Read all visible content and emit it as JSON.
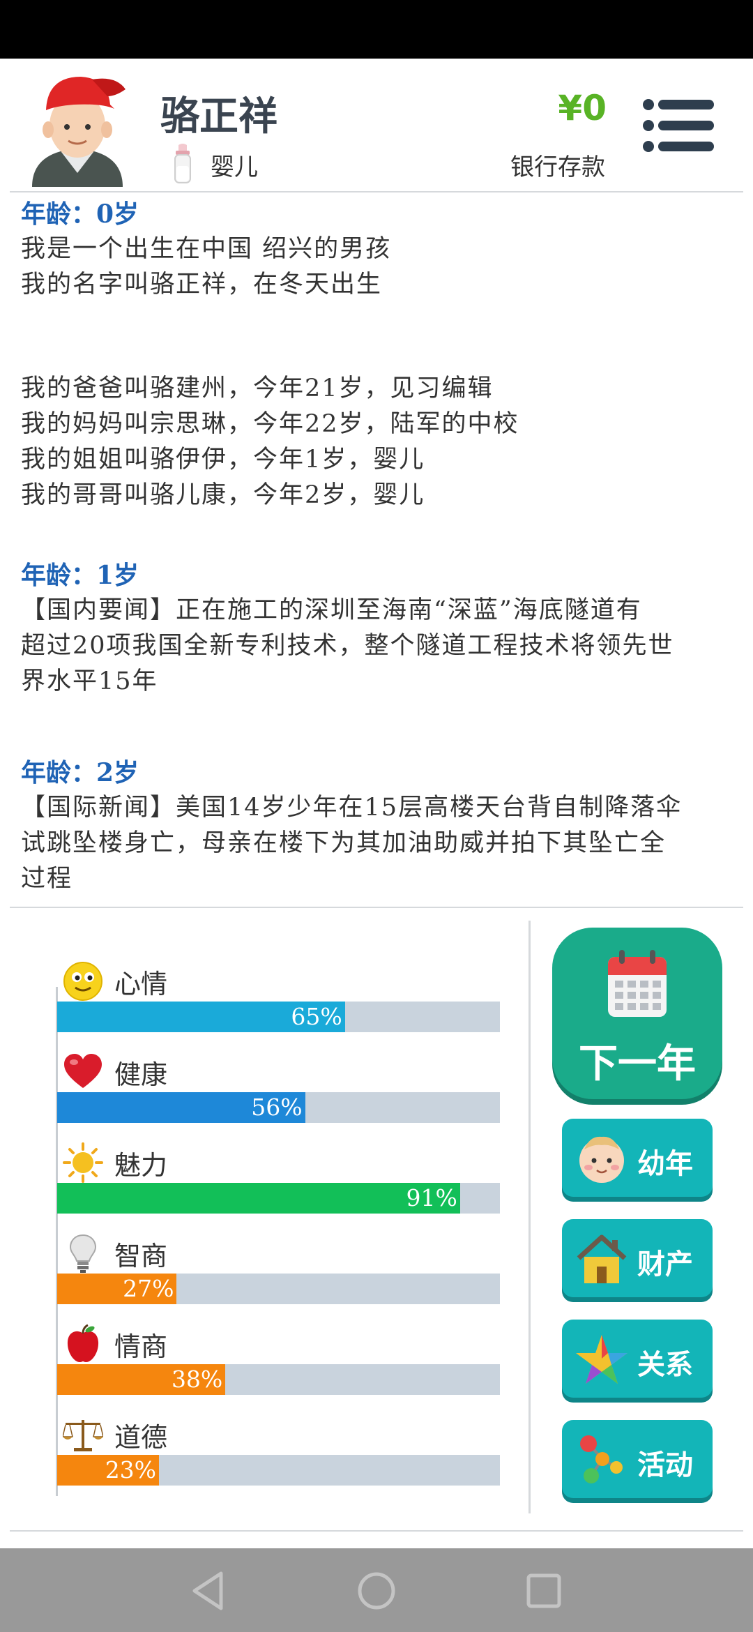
{
  "header": {
    "name": "骆正祥",
    "stage": "婴儿",
    "money": "¥0",
    "bank_label": "银行存款"
  },
  "log": {
    "age0": "年龄：0岁",
    "age0_l1": "我是一个出生在中国 绍兴的男孩",
    "age0_l2": "我的名字叫骆正祥，在冬天出生",
    "fam_l1": "我的爸爸叫骆建州，今年21岁，见习编辑",
    "fam_l2": "我的妈妈叫宗思琳，今年22岁，陆军的中校",
    "fam_l3": "我的姐姐叫骆伊伊，今年1岁，婴儿",
    "fam_l4": "我的哥哥叫骆儿康，今年2岁，婴儿",
    "age1": "年龄：1岁",
    "age1_l1": "【国内要闻】正在施工的深圳至海南“深蓝”海底隧道有",
    "age1_l2": "超过20项我国全新专利技术，整个隧道工程技术将领先世",
    "age1_l3": "界水平15年",
    "age2": "年龄：2岁",
    "age2_l1": "【国际新闻】美国14岁少年在15层高楼天台背自制降落伞",
    "age2_l2": "试跳坠楼身亡，母亲在楼下为其加油助威并拍下其坠亡全",
    "age2_l3": "过程"
  },
  "stats": [
    {
      "label": "心情",
      "value": 65,
      "pct": "65%",
      "color": "#1aaad9",
      "icon": "smiley-icon"
    },
    {
      "label": "健康",
      "value": 56,
      "pct": "56%",
      "color": "#1e88d8",
      "icon": "heart-icon"
    },
    {
      "label": "魅力",
      "value": 91,
      "pct": "91%",
      "color": "#12bf58",
      "icon": "sun-icon"
    },
    {
      "label": "智商",
      "value": 27,
      "pct": "27%",
      "color": "#f5860e",
      "icon": "lightbulb-icon"
    },
    {
      "label": "情商",
      "value": 38,
      "pct": "38%",
      "color": "#f5860e",
      "icon": "apple-icon"
    },
    {
      "label": "道德",
      "value": 23,
      "pct": "23%",
      "color": "#f5860e",
      "icon": "scales-icon"
    }
  ],
  "actions": {
    "next_year": "下一年",
    "childhood": "幼年",
    "assets": "财产",
    "relations": "关系",
    "activities": "活动"
  }
}
